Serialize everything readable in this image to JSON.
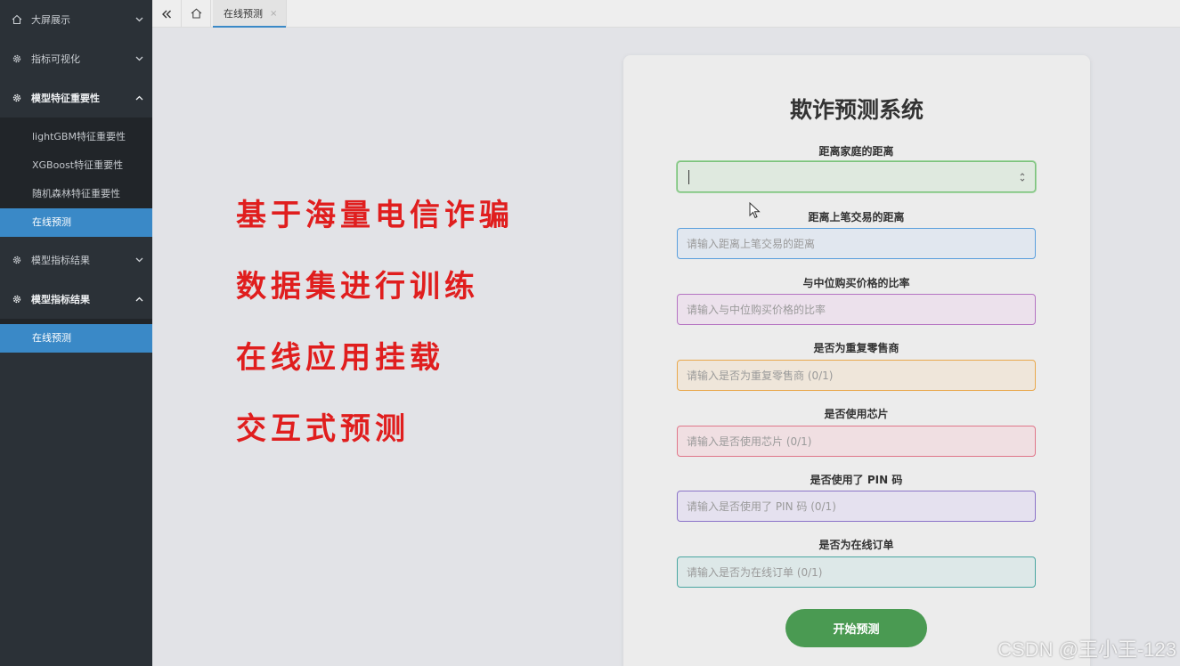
{
  "sidebar": {
    "groups": [
      {
        "label": "大屏展示",
        "icon": "home-icon",
        "expanded": false
      },
      {
        "label": "指标可视化",
        "icon": "gear-icon",
        "expanded": false
      },
      {
        "label": "模型特征重要性",
        "icon": "gear-icon",
        "expanded": true,
        "items": [
          "lightGBM特征重要性",
          "XGBoost特征重要性",
          "随机森林特征重要性",
          "在线预测"
        ]
      },
      {
        "label": "模型指标结果",
        "icon": "gear-icon",
        "expanded": false
      },
      {
        "label": "模型指标结果",
        "icon": "gear-icon",
        "expanded": true,
        "items": [
          "在线预测"
        ]
      }
    ]
  },
  "tabs": {
    "collapse_icon": "double-chevron-left-icon",
    "home_icon": "home-icon",
    "active_label": "在线预测",
    "close_glyph": "×"
  },
  "promo": {
    "lines": [
      "基于海量电信诈骗",
      "数据集进行训练",
      "在线应用挂载",
      "交互式预测"
    ],
    "color": "#e01e1e"
  },
  "form": {
    "title": "欺诈预测系统",
    "fields": [
      {
        "label": "距离家庭的距离",
        "placeholder": "",
        "value": ""
      },
      {
        "label": "距离上笔交易的距离",
        "placeholder": "请输入距离上笔交易的距离",
        "value": ""
      },
      {
        "label": "与中位购买价格的比率",
        "placeholder": "请输入与中位购买价格的比率",
        "value": ""
      },
      {
        "label": "是否为重复零售商",
        "placeholder": "请输入是否为重复零售商 (0/1)",
        "value": ""
      },
      {
        "label": "是否使用芯片",
        "placeholder": "请输入是否使用芯片 (0/1)",
        "value": ""
      },
      {
        "label": "是否使用了 PIN 码",
        "placeholder": "请输入是否使用了 PIN 码 (0/1)",
        "value": ""
      },
      {
        "label": "是否为在线订单",
        "placeholder": "请输入是否为在线订单 (0/1)",
        "value": ""
      }
    ],
    "submit_label": "开始预测",
    "submit_color": "#4a9a52"
  },
  "watermark": "CSDN @王小王-123",
  "colors": {
    "sidebar_bg": "#2b3137",
    "accent": "#3a89c7"
  }
}
